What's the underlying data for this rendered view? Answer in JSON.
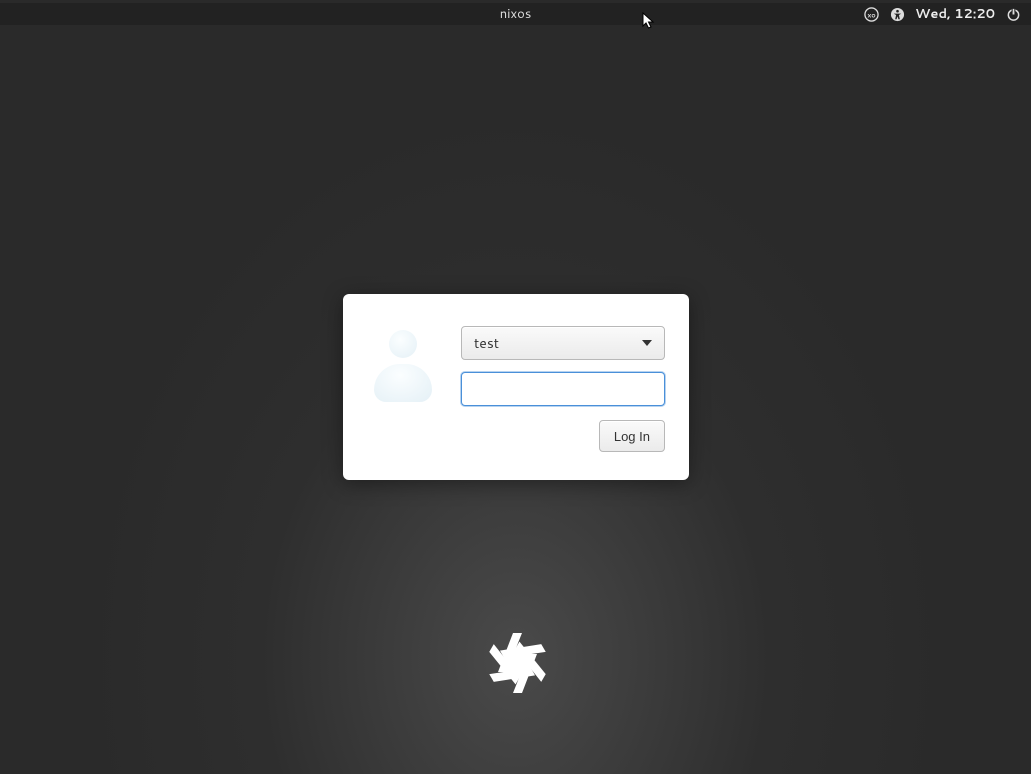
{
  "topbar": {
    "hostname": "nixos",
    "clock": "Wed, 12:20"
  },
  "login": {
    "selected_user": "test",
    "password_value": "",
    "login_button": "Log In"
  }
}
